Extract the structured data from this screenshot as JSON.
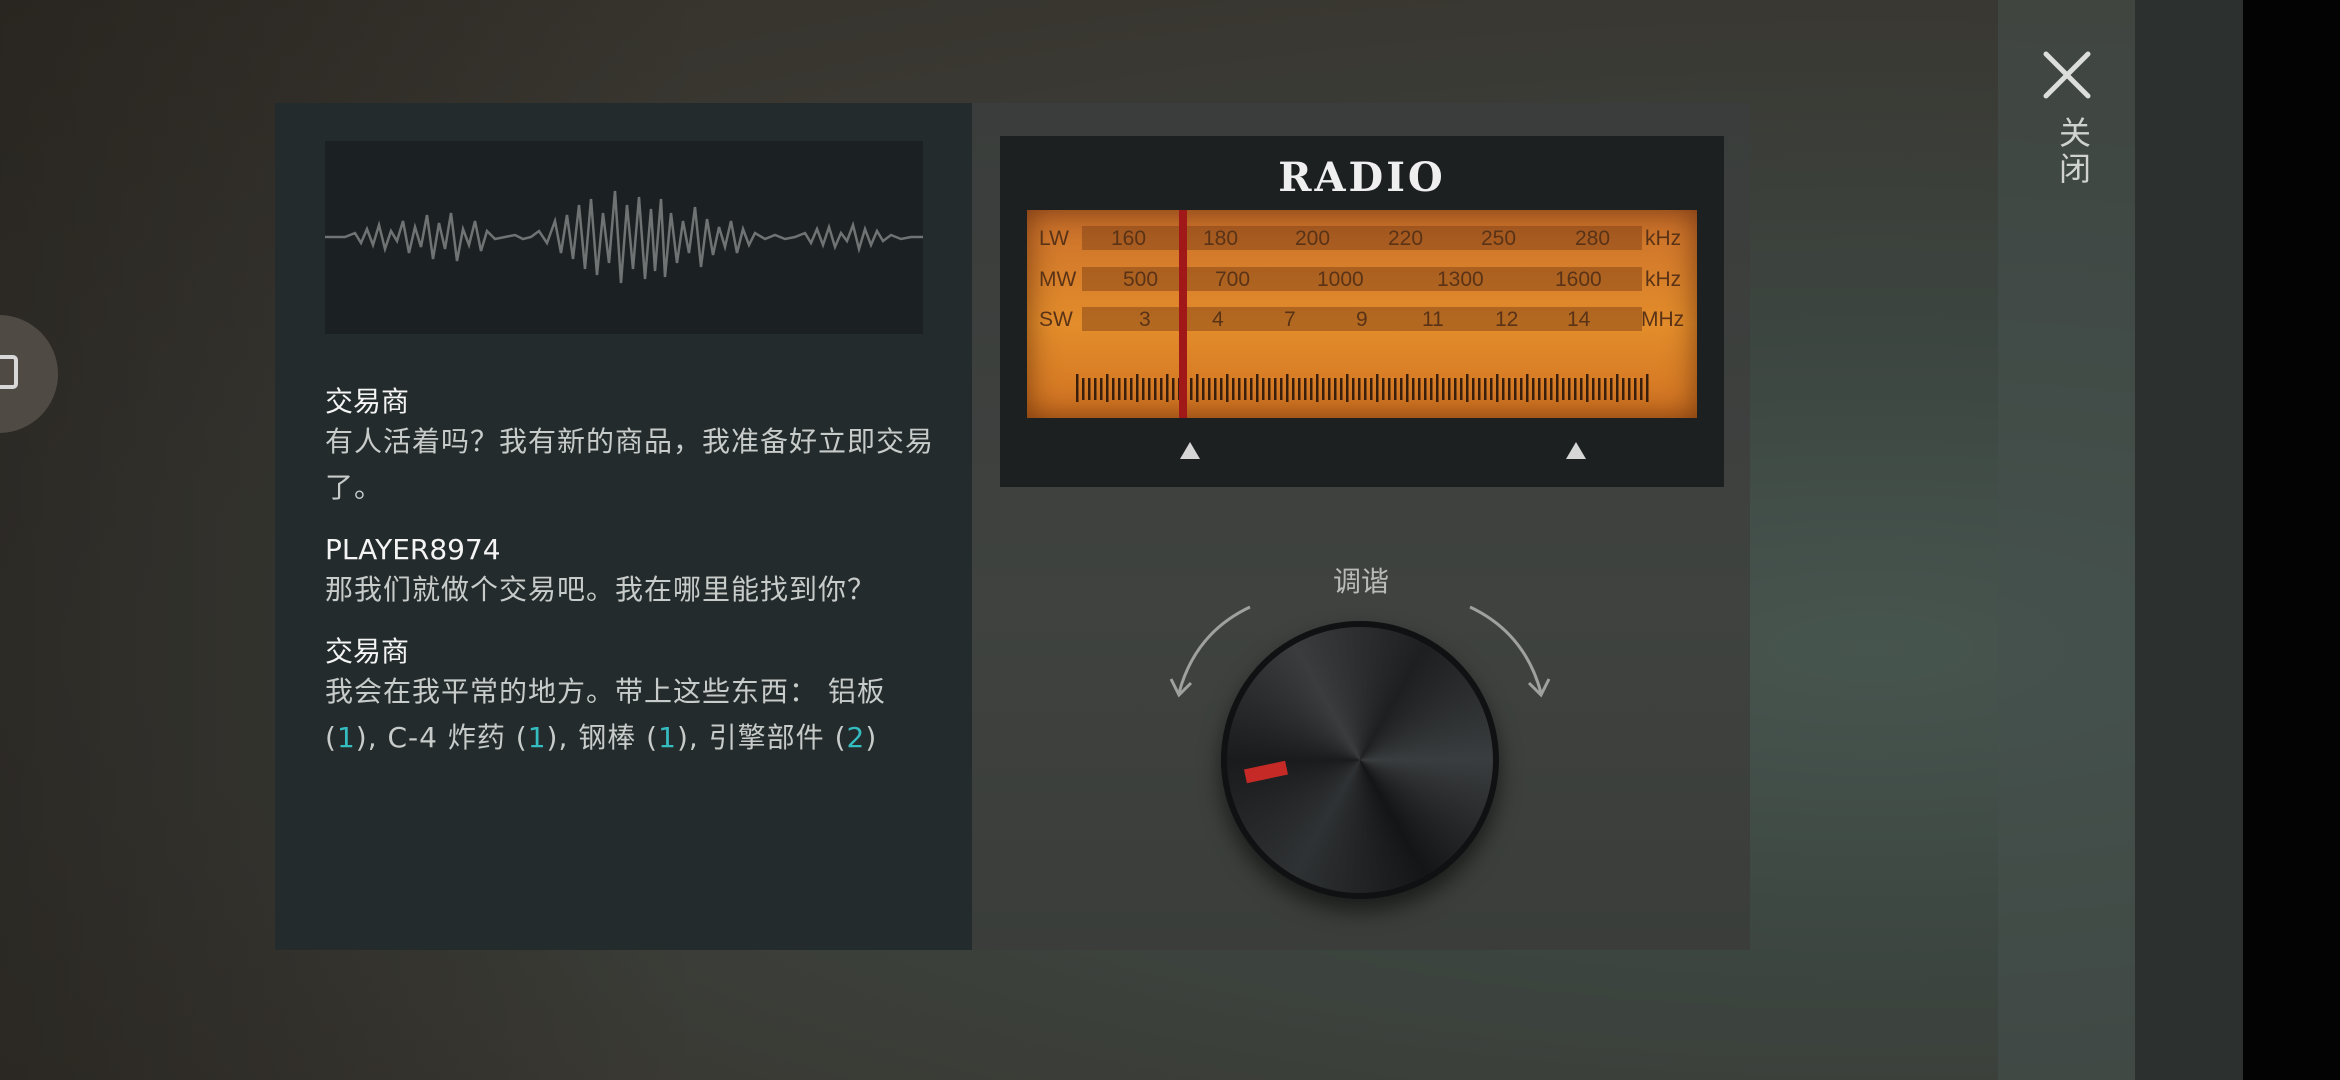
{
  "close": {
    "label": "关闭"
  },
  "chat": [
    {
      "speaker": "交易商",
      "text": "有人活着吗？我有新的商品，我准备好立即交易了。"
    },
    {
      "speaker": "PLAYER8974",
      "text": "那我们就做个交易吧。我在哪里能找到你？"
    },
    {
      "speaker": "交易商",
      "text_intro": "我会在我平常的地方。带上这些东西：",
      "items": [
        {
          "name": "铝板",
          "qty": "1"
        },
        {
          "name": "C-4 炸药",
          "qty": "1"
        },
        {
          "name": "钢棒",
          "qty": "1"
        },
        {
          "name": "引擎部件",
          "qty": "2"
        }
      ]
    }
  ],
  "radio": {
    "title": "RADIO",
    "bands": [
      {
        "name": "LW",
        "unit": "kHz",
        "marks": [
          "160",
          "180",
          "200",
          "220",
          "250",
          "280"
        ]
      },
      {
        "name": "MW",
        "unit": "kHz",
        "marks": [
          "500",
          "700",
          "1000",
          "1300",
          "1600"
        ]
      },
      {
        "name": "SW",
        "unit": "MHz",
        "marks": [
          "3",
          "4",
          "7",
          "9",
          "11",
          "12",
          "14"
        ]
      }
    ],
    "tune_label": "调谐"
  },
  "colors": {
    "highlight": "#35bcc0",
    "needle": "#a01818",
    "dial": "#e38d2b"
  }
}
